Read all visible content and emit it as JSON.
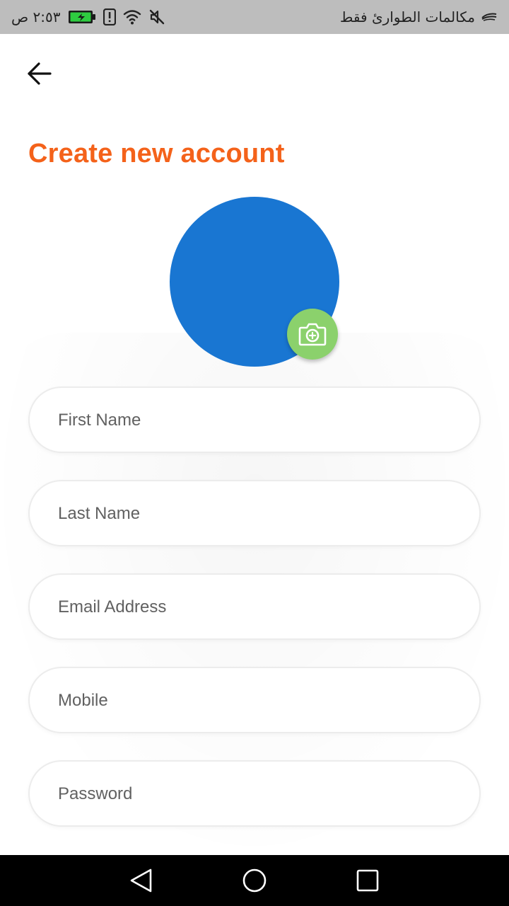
{
  "status_bar": {
    "time": "٢:٥٣ ص",
    "carrier": "مكالمات الطوارئ فقط",
    "icons": [
      "battery-charging-icon",
      "alert-icon",
      "wifi-icon",
      "mute-icon",
      "carrier-logo-icon"
    ]
  },
  "header": {
    "back_icon": "arrow-left-icon",
    "title": "Create new account"
  },
  "avatar": {
    "color": "#1976d2",
    "camera_icon": "camera-icon",
    "camera_button_color": "#8bd16c"
  },
  "form": {
    "first_name": {
      "placeholder": "First Name",
      "value": ""
    },
    "last_name": {
      "placeholder": "Last Name",
      "value": ""
    },
    "email": {
      "placeholder": "Email Address",
      "value": ""
    },
    "mobile": {
      "placeholder": "Mobile",
      "value": ""
    },
    "password": {
      "placeholder": "Password",
      "value": ""
    }
  },
  "nav_bar": {
    "back_icon": "nav-back-icon",
    "home_icon": "nav-home-icon",
    "recents_icon": "nav-recents-icon"
  },
  "colors": {
    "accent": "#f4621a",
    "avatar": "#1976d2",
    "camera": "#8bd16c",
    "status_bar": "#bdbdbd",
    "nav_bar": "#000000"
  }
}
